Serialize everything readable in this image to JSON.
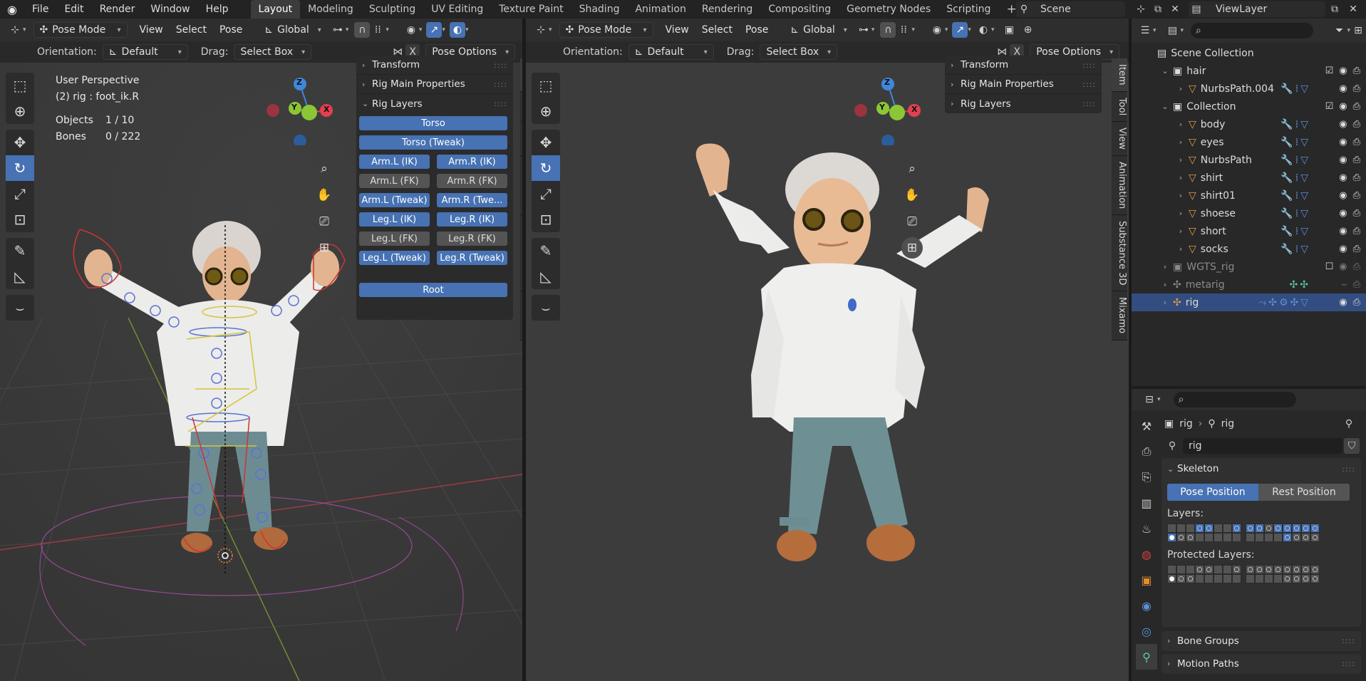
{
  "topbar": {
    "menus": [
      "File",
      "Edit",
      "Render",
      "Window",
      "Help"
    ],
    "workspaces": [
      "Layout",
      "Modeling",
      "Sculpting",
      "UV Editing",
      "Texture Paint",
      "Shading",
      "Animation",
      "Rendering",
      "Compositing",
      "Geometry Nodes",
      "Scripting"
    ],
    "active_workspace": "Layout",
    "add_tab": "+",
    "scene": "Scene",
    "view_layer": "ViewLayer"
  },
  "viewport_left": {
    "mode": "Pose Mode",
    "menus": [
      "View",
      "Select",
      "Pose"
    ],
    "orientation_global": "Global",
    "orientation_label": "Orientation:",
    "orientation_value": "Default",
    "drag_label": "Drag:",
    "drag_value": "Select Box",
    "pose_options": "Pose Options",
    "x_mirror": "X",
    "overlay_title": "User Perspective",
    "overlay_sub": "(2) rig : foot_ik.R",
    "objects_label": "Objects",
    "objects_value": "1 / 10",
    "bones_label": "Bones",
    "bones_value": "0 / 222",
    "panels": {
      "transform": "Transform",
      "rig_main": "Rig Main Properties",
      "rig_layers": "Rig Layers"
    },
    "rig_layer_buttons": [
      {
        "label": "Torso",
        "on": true
      },
      {
        "label": "Torso (Tweak)",
        "on": true
      },
      {
        "label": "Arm.L (IK)",
        "on": true
      },
      {
        "label": "Arm.R (IK)",
        "on": true
      },
      {
        "label": "Arm.L (FK)",
        "on": false
      },
      {
        "label": "Arm.R (FK)",
        "on": false
      },
      {
        "label": "Arm.L (Tweak)",
        "on": true
      },
      {
        "label": "Arm.R (Twe...",
        "on": true
      },
      {
        "label": "Leg.L (IK)",
        "on": true
      },
      {
        "label": "Leg.R (IK)",
        "on": true
      },
      {
        "label": "Leg.L (FK)",
        "on": false
      },
      {
        "label": "Leg.R (FK)",
        "on": false
      },
      {
        "label": "Leg.L (Tweak)",
        "on": true
      },
      {
        "label": "Leg.R (Tweak)",
        "on": true
      },
      {
        "label": "Root",
        "on": true
      }
    ],
    "side_tabs": [
      "Item",
      "Tool",
      "View",
      "Animation",
      "Substance 3D",
      "Mixamo"
    ]
  },
  "viewport_right": {
    "mode": "Pose Mode",
    "menus": [
      "View",
      "Select",
      "Pose"
    ],
    "orientation_global": "Global",
    "orientation_label": "Orientation:",
    "orientation_value": "Default",
    "drag_label": "Drag:",
    "drag_value": "Select Box",
    "pose_options": "Pose Options",
    "x_mirror": "X",
    "panels": {
      "transform": "Transform",
      "rig_main": "Rig Main Properties",
      "rig_layers": "Rig Layers"
    },
    "side_tabs": [
      "Item",
      "Tool",
      "View",
      "Animation",
      "Substance 3D",
      "Mixamo"
    ]
  },
  "gizmo": {
    "z": "Z",
    "y": "Y",
    "x": "X"
  },
  "outliner": {
    "search_placeholder": "",
    "rows": [
      {
        "label": "Scene Collection",
        "indent": 0,
        "type": "scene"
      },
      {
        "label": "hair",
        "indent": 1,
        "type": "collection"
      },
      {
        "label": "NurbsPath.004",
        "indent": 2,
        "type": "object"
      },
      {
        "label": "Collection",
        "indent": 1,
        "type": "collection"
      },
      {
        "label": "body",
        "indent": 2,
        "type": "object"
      },
      {
        "label": "eyes",
        "indent": 2,
        "type": "object"
      },
      {
        "label": "NurbsPath",
        "indent": 2,
        "type": "object"
      },
      {
        "label": "shirt",
        "indent": 2,
        "type": "object"
      },
      {
        "label": "shirt01",
        "indent": 2,
        "type": "object"
      },
      {
        "label": "shoese",
        "indent": 2,
        "type": "object"
      },
      {
        "label": "short",
        "indent": 2,
        "type": "object"
      },
      {
        "label": "socks",
        "indent": 2,
        "type": "object"
      },
      {
        "label": "WGTS_rig",
        "indent": 1,
        "type": "collection-dim"
      },
      {
        "label": "metarig",
        "indent": 1,
        "type": "armature-dim"
      },
      {
        "label": "rig",
        "indent": 1,
        "type": "armature-sel"
      }
    ]
  },
  "properties": {
    "breadcrumb_obj": "rig",
    "breadcrumb_data": "rig",
    "data_name": "rig",
    "skeleton_header": "Skeleton",
    "pose_position": "Pose Position",
    "rest_position": "Rest Position",
    "layers_label": "Layers:",
    "protected_layers_label": "Protected Layers:",
    "bone_groups": "Bone Groups",
    "motion_paths": "Motion Paths"
  },
  "colors": {
    "accent": "#4772b3",
    "selected_row": "#334d80",
    "axis_x": "#e3404f",
    "axis_y": "#8bc735",
    "axis_z": "#3f87db"
  }
}
